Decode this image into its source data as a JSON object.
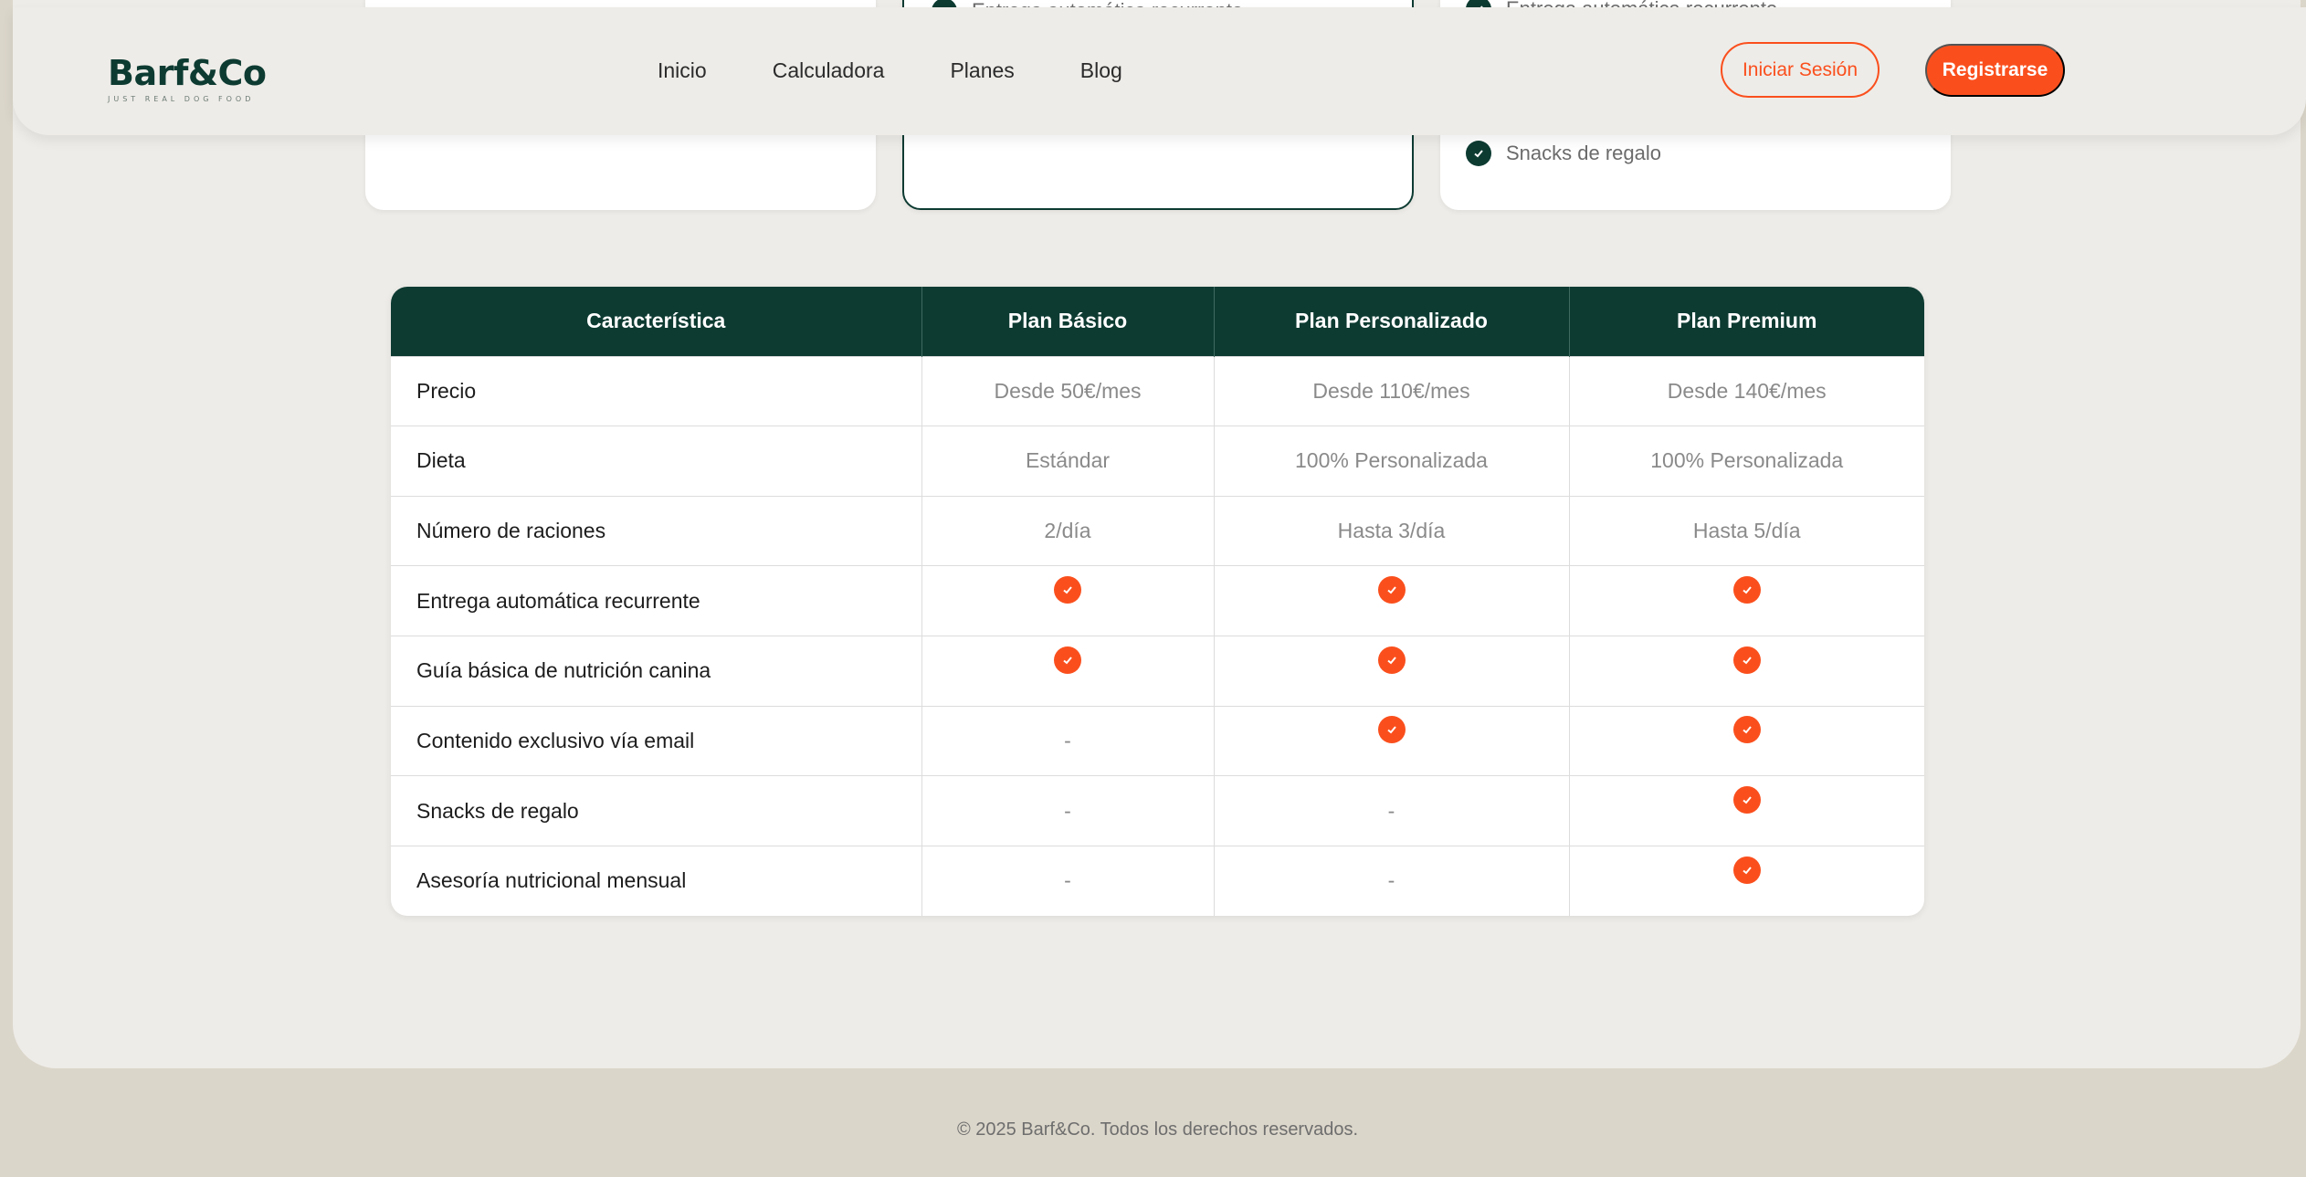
{
  "header": {
    "logo": {
      "name": "Barf&Co",
      "tagline": "JUST REAL DOG FOOD"
    },
    "nav": [
      "Inicio",
      "Calculadora",
      "Planes",
      "Blog"
    ],
    "login_label": "Iniciar Sesión",
    "signup_label": "Registrarse"
  },
  "plan_cards": {
    "custom_visible_feature": "Entrega automática recurrente",
    "premium_visible_feature_top": "Entrega automática recurrente",
    "premium_visible_feature": "Snacks de regalo"
  },
  "comparison_table": {
    "headers": [
      "Característica",
      "Plan Básico",
      "Plan Personalizado",
      "Plan Premium"
    ],
    "rows": [
      {
        "feature": "Precio",
        "basic": "Desde 50€/mes",
        "custom": "Desde 110€/mes",
        "premium": "Desde 140€/mes"
      },
      {
        "feature": "Dieta",
        "basic": "Estándar",
        "custom": "100% Personalizada",
        "premium": "100% Personalizada"
      },
      {
        "feature": "Número de raciones",
        "basic": "2/día",
        "custom": "Hasta 3/día",
        "premium": "Hasta 5/día"
      },
      {
        "feature": "Entrega automática recurrente",
        "basic": true,
        "custom": true,
        "premium": true
      },
      {
        "feature": "Guía básica de nutrición canina",
        "basic": true,
        "custom": true,
        "premium": true
      },
      {
        "feature": "Contenido exclusivo vía email",
        "basic": "-",
        "custom": true,
        "premium": true
      },
      {
        "feature": "Snacks de regalo",
        "basic": "-",
        "custom": "-",
        "premium": true
      },
      {
        "feature": "Asesoría nutricional mensual",
        "basic": "-",
        "custom": "-",
        "premium": true
      }
    ]
  },
  "footer": {
    "copyright": "© 2025 Barf&Co. Todos los derechos reservados."
  },
  "colors": {
    "brand_dark": "#0d3b32",
    "accent": "#fa4f1d",
    "panel": "#eeece8",
    "page_bg": "#dbd6ca"
  }
}
